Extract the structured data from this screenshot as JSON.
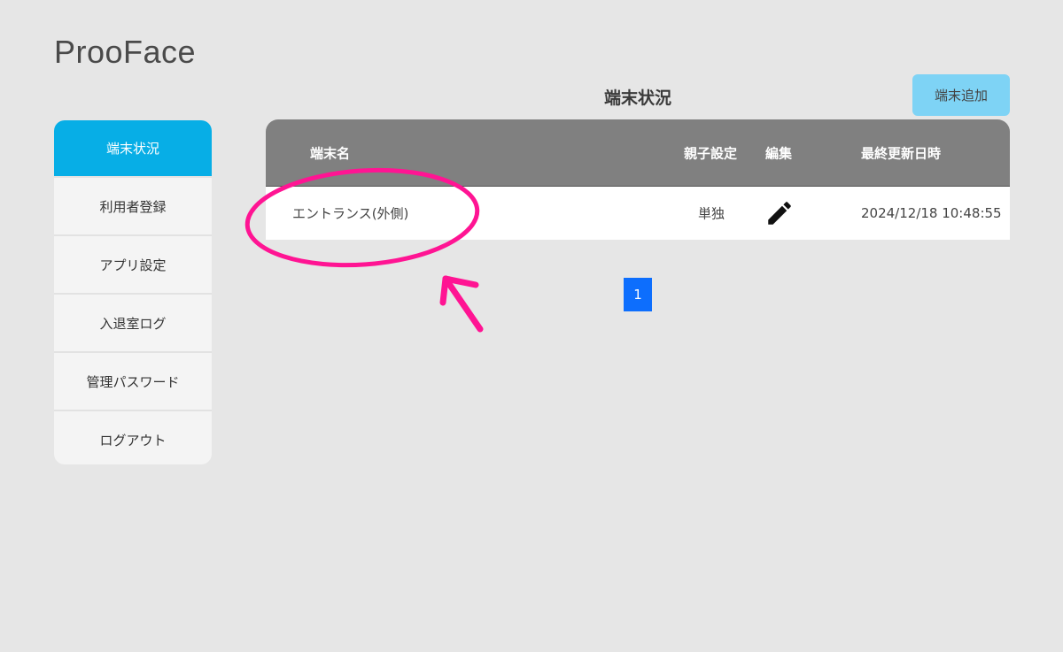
{
  "app": {
    "title": "ProoFace"
  },
  "sidebar": {
    "items": [
      {
        "label": "端末状況",
        "active": true
      },
      {
        "label": "利用者登録",
        "active": false
      },
      {
        "label": "アプリ設定",
        "active": false
      },
      {
        "label": "入退室ログ",
        "active": false
      },
      {
        "label": "管理パスワード",
        "active": false
      },
      {
        "label": "ログアウト",
        "active": false
      }
    ]
  },
  "main": {
    "heading": "端末状況",
    "add_button_label": "端末追加",
    "table": {
      "columns": [
        "端末名",
        "親子設定",
        "編集",
        "最終更新日時"
      ],
      "rows": [
        {
          "name": "エントランス(外側)",
          "parent_setting": "単独",
          "edit_icon": "pencil-icon",
          "updated_at": "2024/12/18 10:48:55"
        }
      ]
    },
    "pagination": {
      "current_page": "1"
    }
  },
  "colors": {
    "background": "#e6e6e6",
    "sidebar_active": "#07aee6",
    "add_button": "#7ed3f5",
    "table_header": "#808080",
    "pagination_active": "#0d6efd",
    "annotation": "#ff1493"
  }
}
